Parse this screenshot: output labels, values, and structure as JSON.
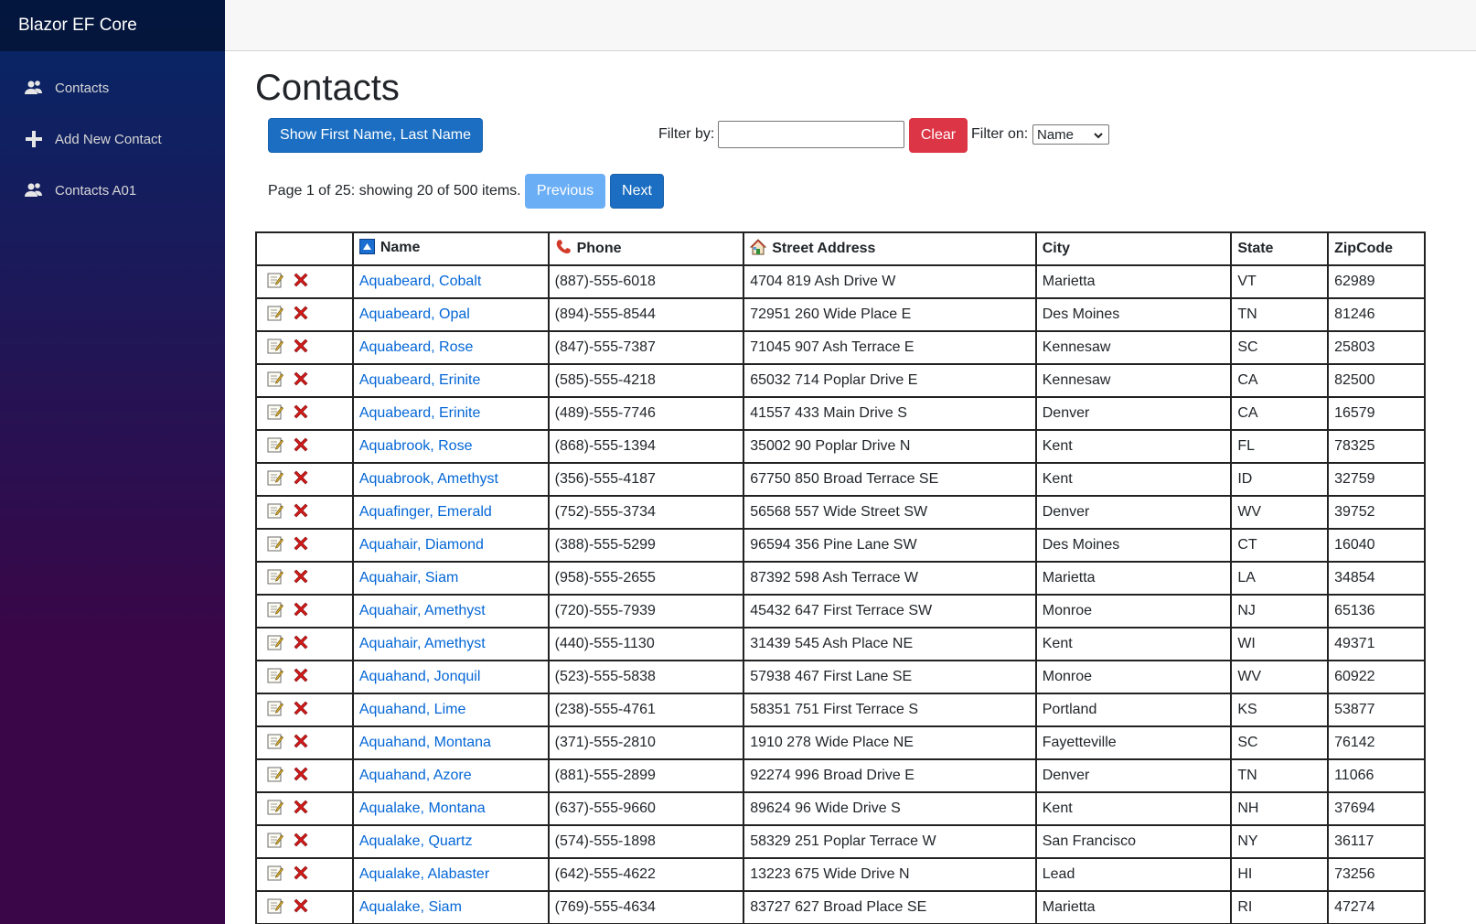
{
  "app": {
    "brand": "Blazor EF Core"
  },
  "sidebar": {
    "items": [
      {
        "label": "Contacts",
        "icon": "people-icon"
      },
      {
        "label": "Add New Contact",
        "icon": "plus-icon"
      },
      {
        "label": "Contacts A01",
        "icon": "people-icon"
      }
    ]
  },
  "main": {
    "title": "Contacts",
    "toggle_button": "Show First Name, Last Name",
    "filter_label": "Filter by:",
    "filter_value": "",
    "clear_button": "Clear",
    "filter_on_label": "Filter on:",
    "filter_on_selected": "Name",
    "page_info": "Page 1 of 25: showing 20 of 500 items.",
    "prev_button": "Previous",
    "next_button": "Next"
  },
  "table": {
    "headers": [
      "Name",
      "Phone",
      "Street Address",
      "City",
      "State",
      "ZipCode"
    ],
    "rows": [
      [
        "Aquabeard, Cobalt",
        "(887)-555-6018",
        "4704 819 Ash Drive W",
        "Marietta",
        "VT",
        "62989"
      ],
      [
        "Aquabeard, Opal",
        "(894)-555-8544",
        "72951 260 Wide Place E",
        "Des Moines",
        "TN",
        "81246"
      ],
      [
        "Aquabeard, Rose",
        "(847)-555-7387",
        "71045 907 Ash Terrace E",
        "Kennesaw",
        "SC",
        "25803"
      ],
      [
        "Aquabeard, Erinite",
        "(585)-555-4218",
        "65032 714 Poplar Drive E",
        "Kennesaw",
        "CA",
        "82500"
      ],
      [
        "Aquabeard, Erinite",
        "(489)-555-7746",
        "41557 433 Main Drive S",
        "Denver",
        "CA",
        "16579"
      ],
      [
        "Aquabrook, Rose",
        "(868)-555-1394",
        "35002 90 Poplar Drive N",
        "Kent",
        "FL",
        "78325"
      ],
      [
        "Aquabrook, Amethyst",
        "(356)-555-4187",
        "67750 850 Broad Terrace SE",
        "Kent",
        "ID",
        "32759"
      ],
      [
        "Aquafinger, Emerald",
        "(752)-555-3734",
        "56568 557 Wide Street SW",
        "Denver",
        "WV",
        "39752"
      ],
      [
        "Aquahair, Diamond",
        "(388)-555-5299",
        "96594 356 Pine Lane SW",
        "Des Moines",
        "CT",
        "16040"
      ],
      [
        "Aquahair, Siam",
        "(958)-555-2655",
        "87392 598 Ash Terrace W",
        "Marietta",
        "LA",
        "34854"
      ],
      [
        "Aquahair, Amethyst",
        "(720)-555-7939",
        "45432 647 First Terrace SW",
        "Monroe",
        "NJ",
        "65136"
      ],
      [
        "Aquahair, Amethyst",
        "(440)-555-1130",
        "31439 545 Ash Place NE",
        "Kent",
        "WI",
        "49371"
      ],
      [
        "Aquahand, Jonquil",
        "(523)-555-5838",
        "57938 467 First Lane SE",
        "Monroe",
        "WV",
        "60922"
      ],
      [
        "Aquahand, Lime",
        "(238)-555-4761",
        "58351 751 First Terrace S",
        "Portland",
        "KS",
        "53877"
      ],
      [
        "Aquahand, Montana",
        "(371)-555-2810",
        "1910 278 Wide Place NE",
        "Fayetteville",
        "SC",
        "76142"
      ],
      [
        "Aquahand, Azore",
        "(881)-555-2899",
        "92274 996 Broad Drive E",
        "Denver",
        "TN",
        "11066"
      ],
      [
        "Aqualake, Montana",
        "(637)-555-9660",
        "89624 96 Wide Drive S",
        "Kent",
        "NH",
        "37694"
      ],
      [
        "Aqualake, Quartz",
        "(574)-555-1898",
        "58329 251 Poplar Terrace W",
        "San Francisco",
        "NY",
        "36117"
      ],
      [
        "Aqualake, Alabaster",
        "(642)-555-4622",
        "13223 675 Wide Drive N",
        "Lead",
        "HI",
        "73256"
      ],
      [
        "Aqualake, Siam",
        "(769)-555-4634",
        "83727 627 Broad Place SE",
        "Marietta",
        "RI",
        "47274"
      ]
    ]
  }
}
